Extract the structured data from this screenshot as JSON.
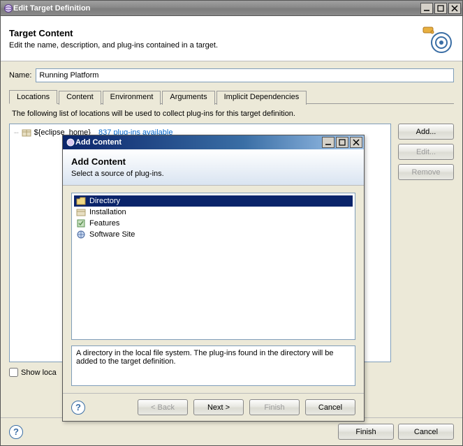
{
  "window": {
    "title": "Edit Target Definition",
    "controls": {
      "minimize": "_",
      "maximize": "□",
      "close": "×"
    }
  },
  "header": {
    "title": "Target Content",
    "description": "Edit the name, description, and plug-ins contained in a target."
  },
  "name": {
    "label": "Name:",
    "value": "Running Platform"
  },
  "tabs": [
    {
      "id": "locations",
      "label": "Locations",
      "active": true
    },
    {
      "id": "content",
      "label": "Content",
      "active": false
    },
    {
      "id": "environment",
      "label": "Environment",
      "active": false
    },
    {
      "id": "arguments",
      "label": "Arguments",
      "active": false
    },
    {
      "id": "implicit",
      "label": "Implicit Dependencies",
      "active": false
    }
  ],
  "locations": {
    "description": "The following list of locations will be used to collect plug-ins for this target definition.",
    "items": [
      {
        "path": "${eclipse_home}",
        "detail": "837 plug-ins available",
        "icon": "archive-icon"
      }
    ],
    "buttons": {
      "add": "Add...",
      "edit": "Edit...",
      "remove": "Remove"
    },
    "show_checkbox_label": "Show loca"
  },
  "footer": {
    "finish": "Finish",
    "cancel": "Cancel"
  },
  "dialog": {
    "title": "Add Content",
    "header_title": "Add Content",
    "header_desc": "Select a source of plug-ins.",
    "items": [
      {
        "id": "directory",
        "label": "Directory",
        "icon": "folder-icon",
        "selected": true
      },
      {
        "id": "installation",
        "label": "Installation",
        "icon": "archive-icon",
        "selected": false
      },
      {
        "id": "features",
        "label": "Features",
        "icon": "feature-icon",
        "selected": false
      },
      {
        "id": "softwaresite",
        "label": "Software Site",
        "icon": "site-icon",
        "selected": false
      }
    ],
    "description": "A directory in the local file system. The plug-ins found in the directory will be added to the target definition.",
    "buttons": {
      "back": "< Back",
      "next": "Next >",
      "finish": "Finish",
      "cancel": "Cancel"
    },
    "controls": {
      "minimize": "_",
      "maximize": "□",
      "close": "×"
    }
  }
}
